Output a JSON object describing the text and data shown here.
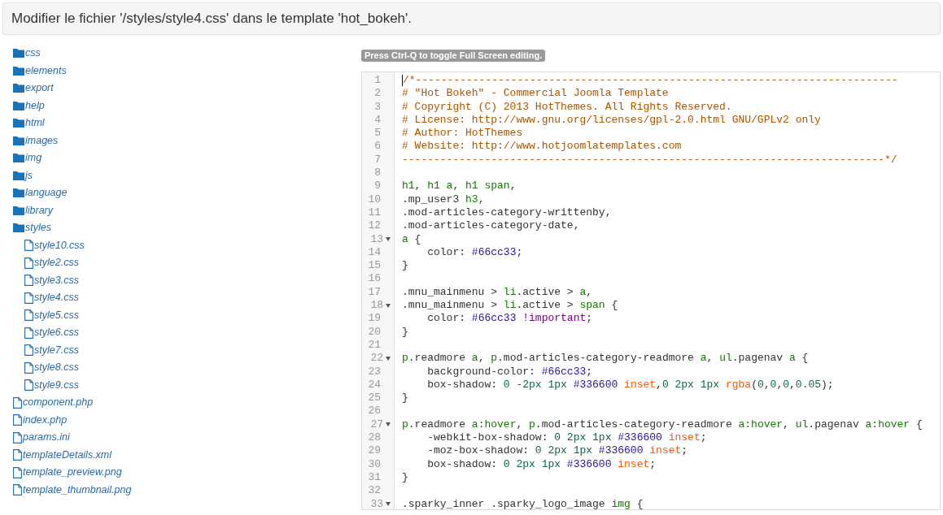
{
  "header": {
    "title": "Modifier le fichier '/styles/style4.css' dans le template 'hot_bokeh'."
  },
  "tree": [
    {
      "name": "css",
      "kind": "folder"
    },
    {
      "name": "elements",
      "kind": "folder"
    },
    {
      "name": "export",
      "kind": "folder"
    },
    {
      "name": "help",
      "kind": "folder"
    },
    {
      "name": "html",
      "kind": "folder"
    },
    {
      "name": "images",
      "kind": "folder"
    },
    {
      "name": "img",
      "kind": "folder"
    },
    {
      "name": "js",
      "kind": "folder"
    },
    {
      "name": "language",
      "kind": "folder"
    },
    {
      "name": "library",
      "kind": "folder"
    },
    {
      "name": "styles",
      "kind": "folder",
      "children": [
        {
          "name": "style10.css",
          "kind": "file"
        },
        {
          "name": "style2.css",
          "kind": "file"
        },
        {
          "name": "style3.css",
          "kind": "file"
        },
        {
          "name": "style4.css",
          "kind": "file"
        },
        {
          "name": "style5.css",
          "kind": "file"
        },
        {
          "name": "style6.css",
          "kind": "file"
        },
        {
          "name": "style7.css",
          "kind": "file"
        },
        {
          "name": "style8.css",
          "kind": "file"
        },
        {
          "name": "style9.css",
          "kind": "file"
        }
      ]
    },
    {
      "name": "component.php",
      "kind": "file"
    },
    {
      "name": "index.php",
      "kind": "file"
    },
    {
      "name": "params.ini",
      "kind": "file"
    },
    {
      "name": "templateDetails.xml",
      "kind": "file"
    },
    {
      "name": "template_preview.png",
      "kind": "file"
    },
    {
      "name": "template_thumbnail.png",
      "kind": "file"
    }
  ],
  "editor": {
    "hint": "Press Ctrl-Q to toggle Full Screen editing.",
    "lines": [
      {
        "number": "1",
        "fold": false,
        "tokens": [
          {
            "text": "/*----------------------------------------------------------------------------",
            "kind": "comment"
          }
        ]
      },
      {
        "number": "2",
        "fold": false,
        "tokens": [
          {
            "text": "# \"Hot Bokeh\" - Commercial Joomla Template",
            "kind": "comment"
          }
        ]
      },
      {
        "number": "3",
        "fold": false,
        "tokens": [
          {
            "text": "# Copyright (C) 2013 HotThemes. All Rights Reserved.",
            "kind": "comment"
          }
        ]
      },
      {
        "number": "4",
        "fold": false,
        "tokens": [
          {
            "text": "# License: http://www.gnu.org/licenses/gpl-2.0.html GNU/GPLv2 only",
            "kind": "comment"
          }
        ]
      },
      {
        "number": "5",
        "fold": false,
        "tokens": [
          {
            "text": "# Author: HotThemes",
            "kind": "comment"
          }
        ]
      },
      {
        "number": "6",
        "fold": false,
        "tokens": [
          {
            "text": "# Website: http://www.hotjoomlatemplates.com",
            "kind": "comment"
          }
        ]
      },
      {
        "number": "7",
        "fold": false,
        "tokens": [
          {
            "text": "----------------------------------------------------------------------------*/",
            "kind": "comment"
          }
        ]
      },
      {
        "number": "8",
        "fold": false
      },
      {
        "number": "9",
        "fold": false,
        "tokens": [
          {
            "text": "h1",
            "kind": "tag"
          },
          {
            "text": ", ",
            "kind": "plain"
          },
          {
            "text": "h1 a",
            "kind": "tag"
          },
          {
            "text": ", ",
            "kind": "plain"
          },
          {
            "text": "h1 span",
            "kind": "tag"
          },
          {
            "text": ",",
            "kind": "plain"
          }
        ]
      },
      {
        "number": "10",
        "fold": false,
        "tokens": [
          {
            "text": ".mp_user3 ",
            "kind": "plain"
          },
          {
            "text": "h3",
            "kind": "tag"
          },
          {
            "text": ",",
            "kind": "plain"
          }
        ]
      },
      {
        "number": "11",
        "fold": false,
        "tokens": [
          {
            "text": ".mod-articles-category-writtenby,",
            "kind": "plain"
          }
        ]
      },
      {
        "number": "12",
        "fold": false,
        "tokens": [
          {
            "text": ".mod-articles-category-date,",
            "kind": "plain"
          }
        ]
      },
      {
        "number": "13",
        "fold": true,
        "tokens": [
          {
            "text": "a",
            "kind": "tag"
          },
          {
            "text": " {",
            "kind": "plain"
          }
        ]
      },
      {
        "number": "14",
        "fold": false,
        "tokens": [
          {
            "text": "    color: ",
            "kind": "plain"
          },
          {
            "text": "#66cc33",
            "kind": "hex"
          },
          {
            "text": ";",
            "kind": "plain"
          }
        ]
      },
      {
        "number": "15",
        "fold": false,
        "tokens": [
          {
            "text": "}",
            "kind": "plain"
          }
        ]
      },
      {
        "number": "16",
        "fold": false
      },
      {
        "number": "17",
        "fold": false,
        "tokens": [
          {
            "text": ".mnu_mainmenu > ",
            "kind": "plain"
          },
          {
            "text": "li",
            "kind": "tag"
          },
          {
            "text": ".active > ",
            "kind": "plain"
          },
          {
            "text": "a",
            "kind": "tag"
          },
          {
            "text": ",",
            "kind": "plain"
          }
        ]
      },
      {
        "number": "18",
        "fold": true,
        "tokens": [
          {
            "text": ".mnu_mainmenu > ",
            "kind": "plain"
          },
          {
            "text": "li",
            "kind": "tag"
          },
          {
            "text": ".active > ",
            "kind": "plain"
          },
          {
            "text": "span",
            "kind": "tag"
          },
          {
            "text": " {",
            "kind": "plain"
          }
        ]
      },
      {
        "number": "19",
        "fold": false,
        "tokens": [
          {
            "text": "    color: ",
            "kind": "plain"
          },
          {
            "text": "#66cc33 ",
            "kind": "hex"
          },
          {
            "text": "!important",
            "kind": "keyword"
          },
          {
            "text": ";",
            "kind": "plain"
          }
        ]
      },
      {
        "number": "20",
        "fold": false,
        "tokens": [
          {
            "text": "}",
            "kind": "plain"
          }
        ]
      },
      {
        "number": "21",
        "fold": false
      },
      {
        "number": "22",
        "fold": true,
        "tokens": [
          {
            "text": "p",
            "kind": "tag"
          },
          {
            "text": ".readmore ",
            "kind": "plain"
          },
          {
            "text": "a",
            "kind": "tag"
          },
          {
            "text": ", ",
            "kind": "plain"
          },
          {
            "text": "p",
            "kind": "tag"
          },
          {
            "text": ".mod-articles-category-readmore ",
            "kind": "plain"
          },
          {
            "text": "a",
            "kind": "tag"
          },
          {
            "text": ", ",
            "kind": "plain"
          },
          {
            "text": "ul",
            "kind": "tag"
          },
          {
            "text": ".pagenav ",
            "kind": "plain"
          },
          {
            "text": "a",
            "kind": "tag"
          },
          {
            "text": " {",
            "kind": "plain"
          }
        ]
      },
      {
        "number": "23",
        "fold": false,
        "tokens": [
          {
            "text": "    background-color: ",
            "kind": "plain"
          },
          {
            "text": "#66cc33",
            "kind": "hex"
          },
          {
            "text": ";",
            "kind": "plain"
          }
        ]
      },
      {
        "number": "24",
        "fold": false,
        "tokens": [
          {
            "text": "    box-shadow: ",
            "kind": "plain"
          },
          {
            "text": "0 -2px 1px ",
            "kind": "number"
          },
          {
            "text": "#336600 ",
            "kind": "hex"
          },
          {
            "text": "inset",
            "kind": "atom"
          },
          {
            "text": ",",
            "kind": "plain"
          },
          {
            "text": "0 2px 1px ",
            "kind": "number"
          },
          {
            "text": "rgba",
            "kind": "atom"
          },
          {
            "text": "(",
            "kind": "plain"
          },
          {
            "text": "0",
            "kind": "number"
          },
          {
            "text": ",",
            "kind": "plain"
          },
          {
            "text": "0",
            "kind": "number"
          },
          {
            "text": ",",
            "kind": "plain"
          },
          {
            "text": "0",
            "kind": "number"
          },
          {
            "text": ",",
            "kind": "plain"
          },
          {
            "text": "0.05",
            "kind": "number"
          },
          {
            "text": ");",
            "kind": "plain"
          }
        ]
      },
      {
        "number": "25",
        "fold": false,
        "tokens": [
          {
            "text": "}",
            "kind": "plain"
          }
        ]
      },
      {
        "number": "26",
        "fold": false
      },
      {
        "number": "27",
        "fold": true,
        "tokens": [
          {
            "text": "p",
            "kind": "tag"
          },
          {
            "text": ".readmore ",
            "kind": "plain"
          },
          {
            "text": "a:hover",
            "kind": "tag"
          },
          {
            "text": ", ",
            "kind": "plain"
          },
          {
            "text": "p",
            "kind": "tag"
          },
          {
            "text": ".mod-articles-category-readmore ",
            "kind": "plain"
          },
          {
            "text": "a:hover",
            "kind": "tag"
          },
          {
            "text": ", ",
            "kind": "plain"
          },
          {
            "text": "ul",
            "kind": "tag"
          },
          {
            "text": ".pagenav ",
            "kind": "plain"
          },
          {
            "text": "a:hover",
            "kind": "tag"
          },
          {
            "text": " {",
            "kind": "plain"
          }
        ]
      },
      {
        "number": "28",
        "fold": false,
        "tokens": [
          {
            "text": "    -webkit-box-shadow: ",
            "kind": "plain"
          },
          {
            "text": "0 2px 1px ",
            "kind": "number"
          },
          {
            "text": "#336600 ",
            "kind": "hex"
          },
          {
            "text": "inset",
            "kind": "atom"
          },
          {
            "text": ";",
            "kind": "plain"
          }
        ]
      },
      {
        "number": "29",
        "fold": false,
        "tokens": [
          {
            "text": "    -moz-box-shadow: ",
            "kind": "plain"
          },
          {
            "text": "0 2px 1px ",
            "kind": "number"
          },
          {
            "text": "#336600 ",
            "kind": "hex"
          },
          {
            "text": "inset",
            "kind": "atom"
          },
          {
            "text": ";",
            "kind": "plain"
          }
        ]
      },
      {
        "number": "30",
        "fold": false,
        "tokens": [
          {
            "text": "    box-shadow: ",
            "kind": "plain"
          },
          {
            "text": "0 2px 1px ",
            "kind": "number"
          },
          {
            "text": "#336600 ",
            "kind": "hex"
          },
          {
            "text": "inset",
            "kind": "atom"
          },
          {
            "text": ";",
            "kind": "plain"
          }
        ]
      },
      {
        "number": "31",
        "fold": false,
        "tokens": [
          {
            "text": "}",
            "kind": "plain"
          }
        ]
      },
      {
        "number": "32",
        "fold": false
      },
      {
        "number": "33",
        "fold": true,
        "tokens": [
          {
            "text": ".sparky_inner .sparky_logo_image ",
            "kind": "plain"
          },
          {
            "text": "img",
            "kind": "tag"
          },
          {
            "text": " {",
            "kind": "plain"
          }
        ]
      }
    ]
  }
}
